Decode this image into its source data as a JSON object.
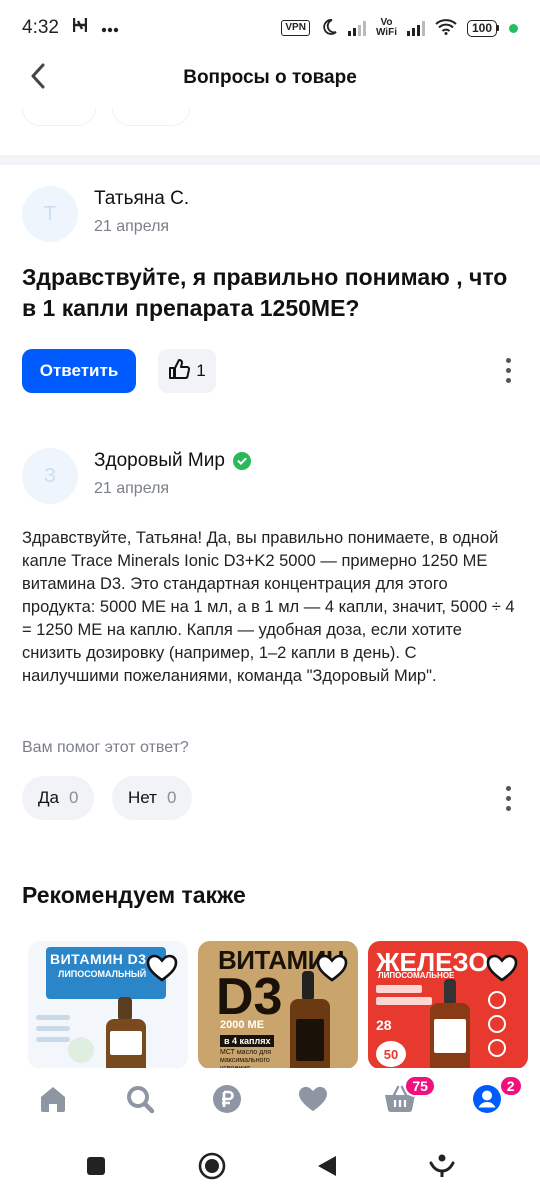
{
  "status_bar": {
    "time": "4:32",
    "left_icons": [
      "app-h-icon",
      "more-dots-icon"
    ],
    "vpn": "VPN",
    "wifi_label_top": "Vo",
    "wifi_label_bottom": "WiFi",
    "battery": "100"
  },
  "header": {
    "title": "Вопросы о товаре"
  },
  "question_block": {
    "author_initial": "Т",
    "author": "Татьяна С.",
    "date": "21 апреля",
    "question": "Здравствуйте, я правильно понимаю , что в 1 капли препарата 1250МЕ?",
    "answer_button": "Ответить",
    "likes": "1"
  },
  "answer_block": {
    "author_initial": "З",
    "author": "Здоровый Мир",
    "date": "21 апреля",
    "text": "Здравствуйте, Татьяна! Да, вы правильно понимаете, в одной капле Trace Minerals Ionic D3+K2 5000 — примерно 1250 МЕ витамина D3. Это стандартная концентрация для этого продукта: 5000 МЕ на 1 мл, а в 1 мл — 4 капли, значит, 5000 ÷ 4 = 1250 МЕ на каплю. Капля — удобная доза, если хотите снизить дозировку (например, 1–2 капли в день). С наилучшими пожеланиями, команда \"Здоровый Мир\".",
    "helpful_question": "Вам помог этот ответ?",
    "yes_label": "Да",
    "yes_count": "0",
    "no_label": "Нет",
    "no_count": "0"
  },
  "recommend": {
    "title": "Рекомендуем также",
    "cards": [
      {
        "title_line1": "ВИТАМИН D3",
        "title_line2": "ЛИПОСОМАЛЬНЫЙ",
        "bg": "#e9f2fb",
        "accent": "#1f7bbf"
      },
      {
        "title_line1": "ВИТАМИН",
        "title_line2": "D3",
        "sub1": "2000 МЕ",
        "sub2": "в 4 каплях",
        "sub3": "МСТ масло для максимального усвоения",
        "bg": "#c9a46c",
        "accent": "#1a1208"
      },
      {
        "title_line1": "ЖЕЛЕЗО",
        "title_line2": "ЛИПОСОМАЛЬНОЕ",
        "sub1": "28",
        "sub2": "50",
        "bg": "#e8392f",
        "accent": "#ffffff"
      }
    ]
  },
  "bottom_nav": {
    "items": [
      "home-icon",
      "search-icon",
      "ruble-icon",
      "heart-icon",
      "cart-icon",
      "profile-icon"
    ],
    "cart_badge": "75",
    "profile_badge": "2"
  },
  "colors": {
    "primary": "#005bff",
    "badge": "#f1117e",
    "verified": "#2ab859"
  }
}
